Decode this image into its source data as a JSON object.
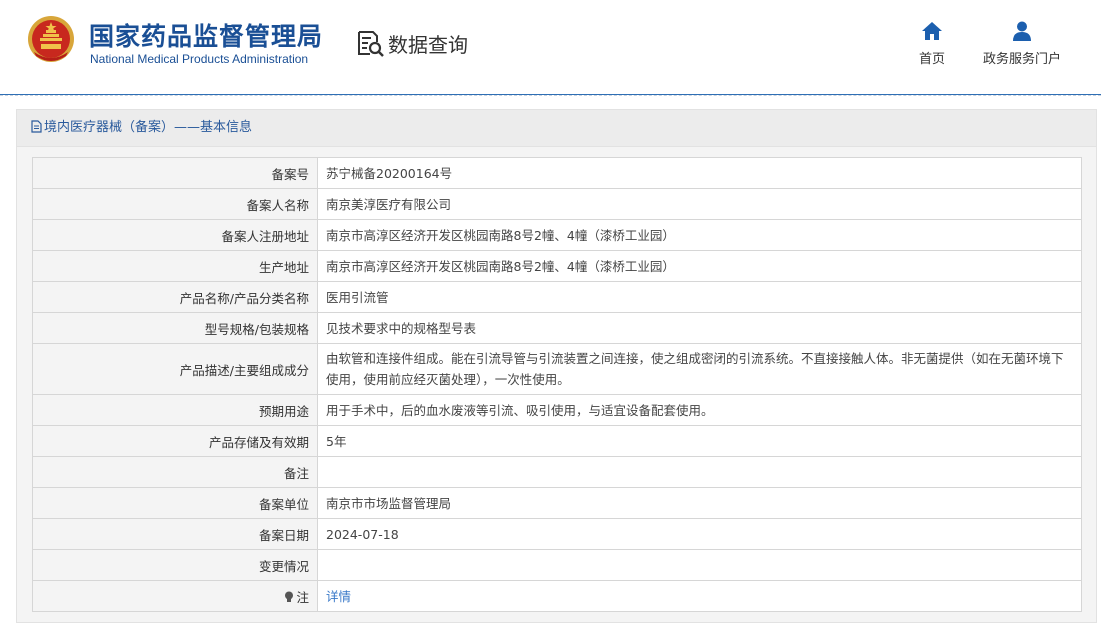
{
  "header": {
    "brand_cn": "国家药品监督管理局",
    "brand_en": "National Medical Products Administration",
    "query_label": "数据查询",
    "nav": {
      "home": "首页",
      "portal": "政务服务门户"
    }
  },
  "panel": {
    "title": "境内医疗器械（备案）——基本信息"
  },
  "rows": [
    {
      "label": "备案号",
      "value": "苏宁械备20200164号"
    },
    {
      "label": "备案人名称",
      "value": "南京美淳医疗有限公司"
    },
    {
      "label": "备案人注册地址",
      "value": "南京市高淳区经济开发区桃园南路8号2幢、4幢（漆桥工业园）"
    },
    {
      "label": "生产地址",
      "value": "南京市高淳区经济开发区桃园南路8号2幢、4幢（漆桥工业园）"
    },
    {
      "label": "产品名称/产品分类名称",
      "value": "医用引流管"
    },
    {
      "label": "型号规格/包装规格",
      "value": "见技术要求中的规格型号表"
    },
    {
      "label": "产品描述/主要组成成分",
      "value": "由软管和连接件组成。能在引流导管与引流装置之间连接，使之组成密闭的引流系统。不直接接触人体。非无菌提供（如在无菌环境下使用，使用前应经灭菌处理），一次性使用。"
    },
    {
      "label": "预期用途",
      "value": "用于手术中，后的血水废液等引流、吸引使用，与适宜设备配套使用。"
    },
    {
      "label": "产品存储及有效期",
      "value": "5年"
    },
    {
      "label": "备注",
      "value": ""
    },
    {
      "label": "备案单位",
      "value": "南京市市场监督管理局"
    },
    {
      "label": "备案日期",
      "value": "2024-07-18"
    },
    {
      "label": "变更情况",
      "value": ""
    },
    {
      "label": "注",
      "value": "详情"
    }
  ],
  "colors": {
    "brand_blue": "#1a4f95",
    "link_blue": "#3878c8",
    "nav_blue": "#1c5fae"
  },
  "icons": {
    "emblem": "national-emblem-icon",
    "query": "document-search-icon",
    "home": "home-icon",
    "portal": "user-icon",
    "panel": "document-icon",
    "note": "lightbulb-icon"
  }
}
